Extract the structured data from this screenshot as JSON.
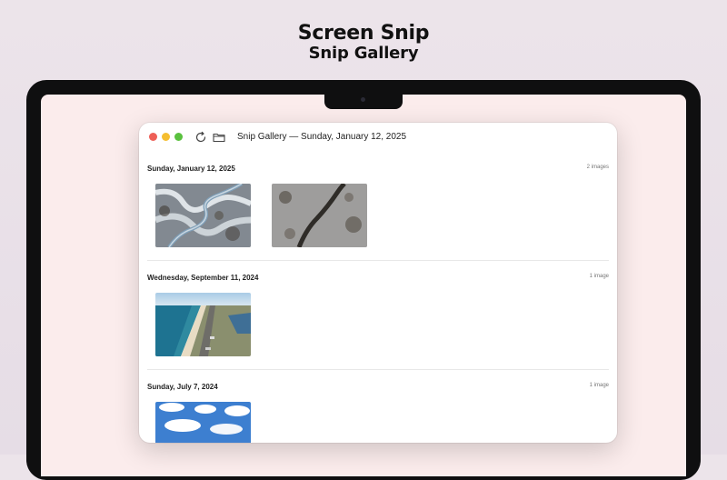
{
  "hero": {
    "title": "Screen Snip",
    "subtitle": "Snip Gallery"
  },
  "window": {
    "title": "Snip Gallery — Sunday, January 12, 2025",
    "toolbar_icons": [
      "refresh-icon",
      "folder-icon"
    ]
  },
  "sections": [
    {
      "date": "Sunday, January 12, 2025",
      "count": "2 images",
      "thumbnails": [
        "snowy-winding-road-aerial",
        "snowy-forest-road-aerial"
      ]
    },
    {
      "date": "Wednesday, September 11, 2024",
      "count": "1 image",
      "thumbnails": [
        "coastline-aerial"
      ]
    },
    {
      "date": "Sunday, July 7, 2024",
      "count": "1 image",
      "thumbnails": [
        "blue-sky-clouds"
      ]
    }
  ],
  "colors": {
    "traffic_red": "#ee5f57",
    "traffic_yellow": "#f5be30",
    "traffic_green": "#5ac13f",
    "screen_bg": "#fbecec"
  }
}
